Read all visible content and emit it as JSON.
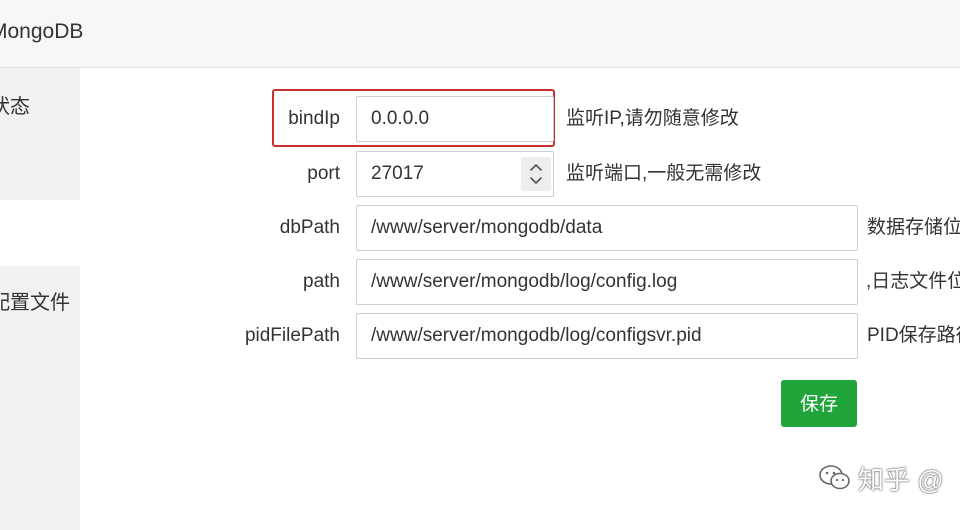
{
  "window": {
    "title": "MongoDB"
  },
  "sidebar": {
    "items": [
      {
        "label": "状态"
      },
      {
        "label": ""
      },
      {
        "label": "配置文件"
      }
    ]
  },
  "form": {
    "fields": [
      {
        "label": "bindIp",
        "value": "0.0.0.0",
        "hint": "监听IP,请勿随意修改"
      },
      {
        "label": "port",
        "value": "27017",
        "hint": "监听端口,一般无需修改"
      },
      {
        "label": "dbPath",
        "value": "/www/server/mongodb/data",
        "hint": "数据存储位置"
      },
      {
        "label": "path",
        "value": "/www/server/mongodb/log/config.log",
        "hint": ",日志文件位置"
      },
      {
        "label": "pidFilePath",
        "value": "/www/server/mongodb/log/configsvr.pid",
        "hint": "PID保存路径"
      }
    ],
    "save_label": "保存"
  },
  "annotations": {
    "highlight_color": "#c9302c"
  },
  "colors": {
    "primary_button": "#20a53a",
    "sidebar_bg": "#f2f2f2",
    "titlebar_bg": "#f7f7f7"
  },
  "watermark": {
    "text": "知乎 @",
    "icon": "wechat-icon"
  }
}
